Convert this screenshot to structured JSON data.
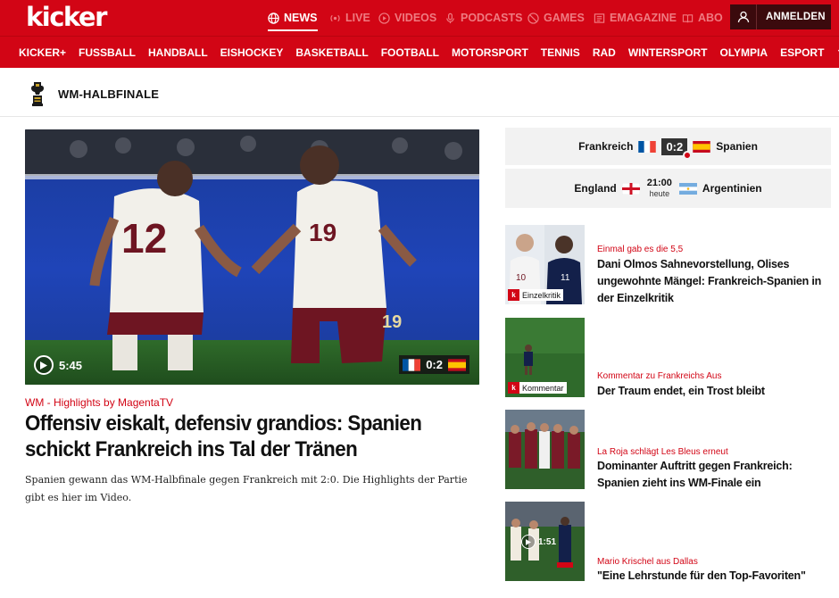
{
  "header": {
    "logo": "kicker",
    "nav": [
      {
        "label": "NEWS",
        "icon": "globe-icon",
        "active": true
      },
      {
        "label": "LIVE",
        "icon": "live-icon"
      },
      {
        "label": "VIDEOS",
        "icon": "play-icon"
      },
      {
        "label": "PODCASTS",
        "icon": "microphone-icon"
      },
      {
        "label": "GAMES",
        "icon": "games-icon"
      },
      {
        "label": "EMAGAZINE",
        "icon": "magazine-icon"
      },
      {
        "label": "ABO",
        "icon": "book-icon"
      }
    ],
    "login_label": "ANMELDEN"
  },
  "sports_nav": [
    "KICKER+",
    "FUSSBALL",
    "HANDBALL",
    "EISHOCKEY",
    "BASKETBALL",
    "FOOTBALL",
    "MOTORSPORT",
    "TENNIS",
    "RAD",
    "WINTERSPORT",
    "OLYMPIA",
    "ESPORT"
  ],
  "event": {
    "title": "WM-HALBFINALE",
    "icon": "trophy-icon"
  },
  "hero": {
    "video_duration": "5:45",
    "score": "0:2",
    "kicker": "WM - Highlights by MagentaTV",
    "title": "Offensiv eiskalt, defensiv grandios: Spanien schickt Frankreich ins Tal der Tränen",
    "teaser": "Spanien gewann das WM-Halbfinale gegen Frankreich mit 2:0. Die Highlights der Partie gibt es hier im Video."
  },
  "matches": [
    {
      "home": "Frankreich",
      "away": "Spanien",
      "score": "0:2",
      "home_flag": "france-flag",
      "away_flag": "spain-flag"
    },
    {
      "home": "England",
      "away": "Argentinien",
      "time": "21:00",
      "day": "heute",
      "home_flag": "england-flag",
      "away_flag": "argentina-flag"
    }
  ],
  "side_articles": [
    {
      "kicker": "Einmal gab es die 5,5",
      "title": "Dani Olmos Sahnevorstellung, Olises ungewohnte Mängel: Frankreich-Spanien in der Einzelkritik",
      "tag": "Einzelkritik"
    },
    {
      "kicker": "Kommentar zu Frankreichs Aus",
      "title": "Der Traum endet, ein Trost bleibt",
      "tag": "Kommentar"
    },
    {
      "kicker": "La Roja schlägt Les Bleus erneut",
      "title": "Dominanter Auftritt gegen Frankreich: Spanien zieht ins WM-Finale ein"
    },
    {
      "kicker": "Mario Krischel aus Dallas",
      "title": "\"Eine Lehrstunde für den Top-Favoriten\"",
      "video_duration": "1:51"
    }
  ],
  "colors": {
    "brand_red": "#d20515",
    "login_dark": "#3b0a0d",
    "widget_bg": "#f2f2f2"
  }
}
